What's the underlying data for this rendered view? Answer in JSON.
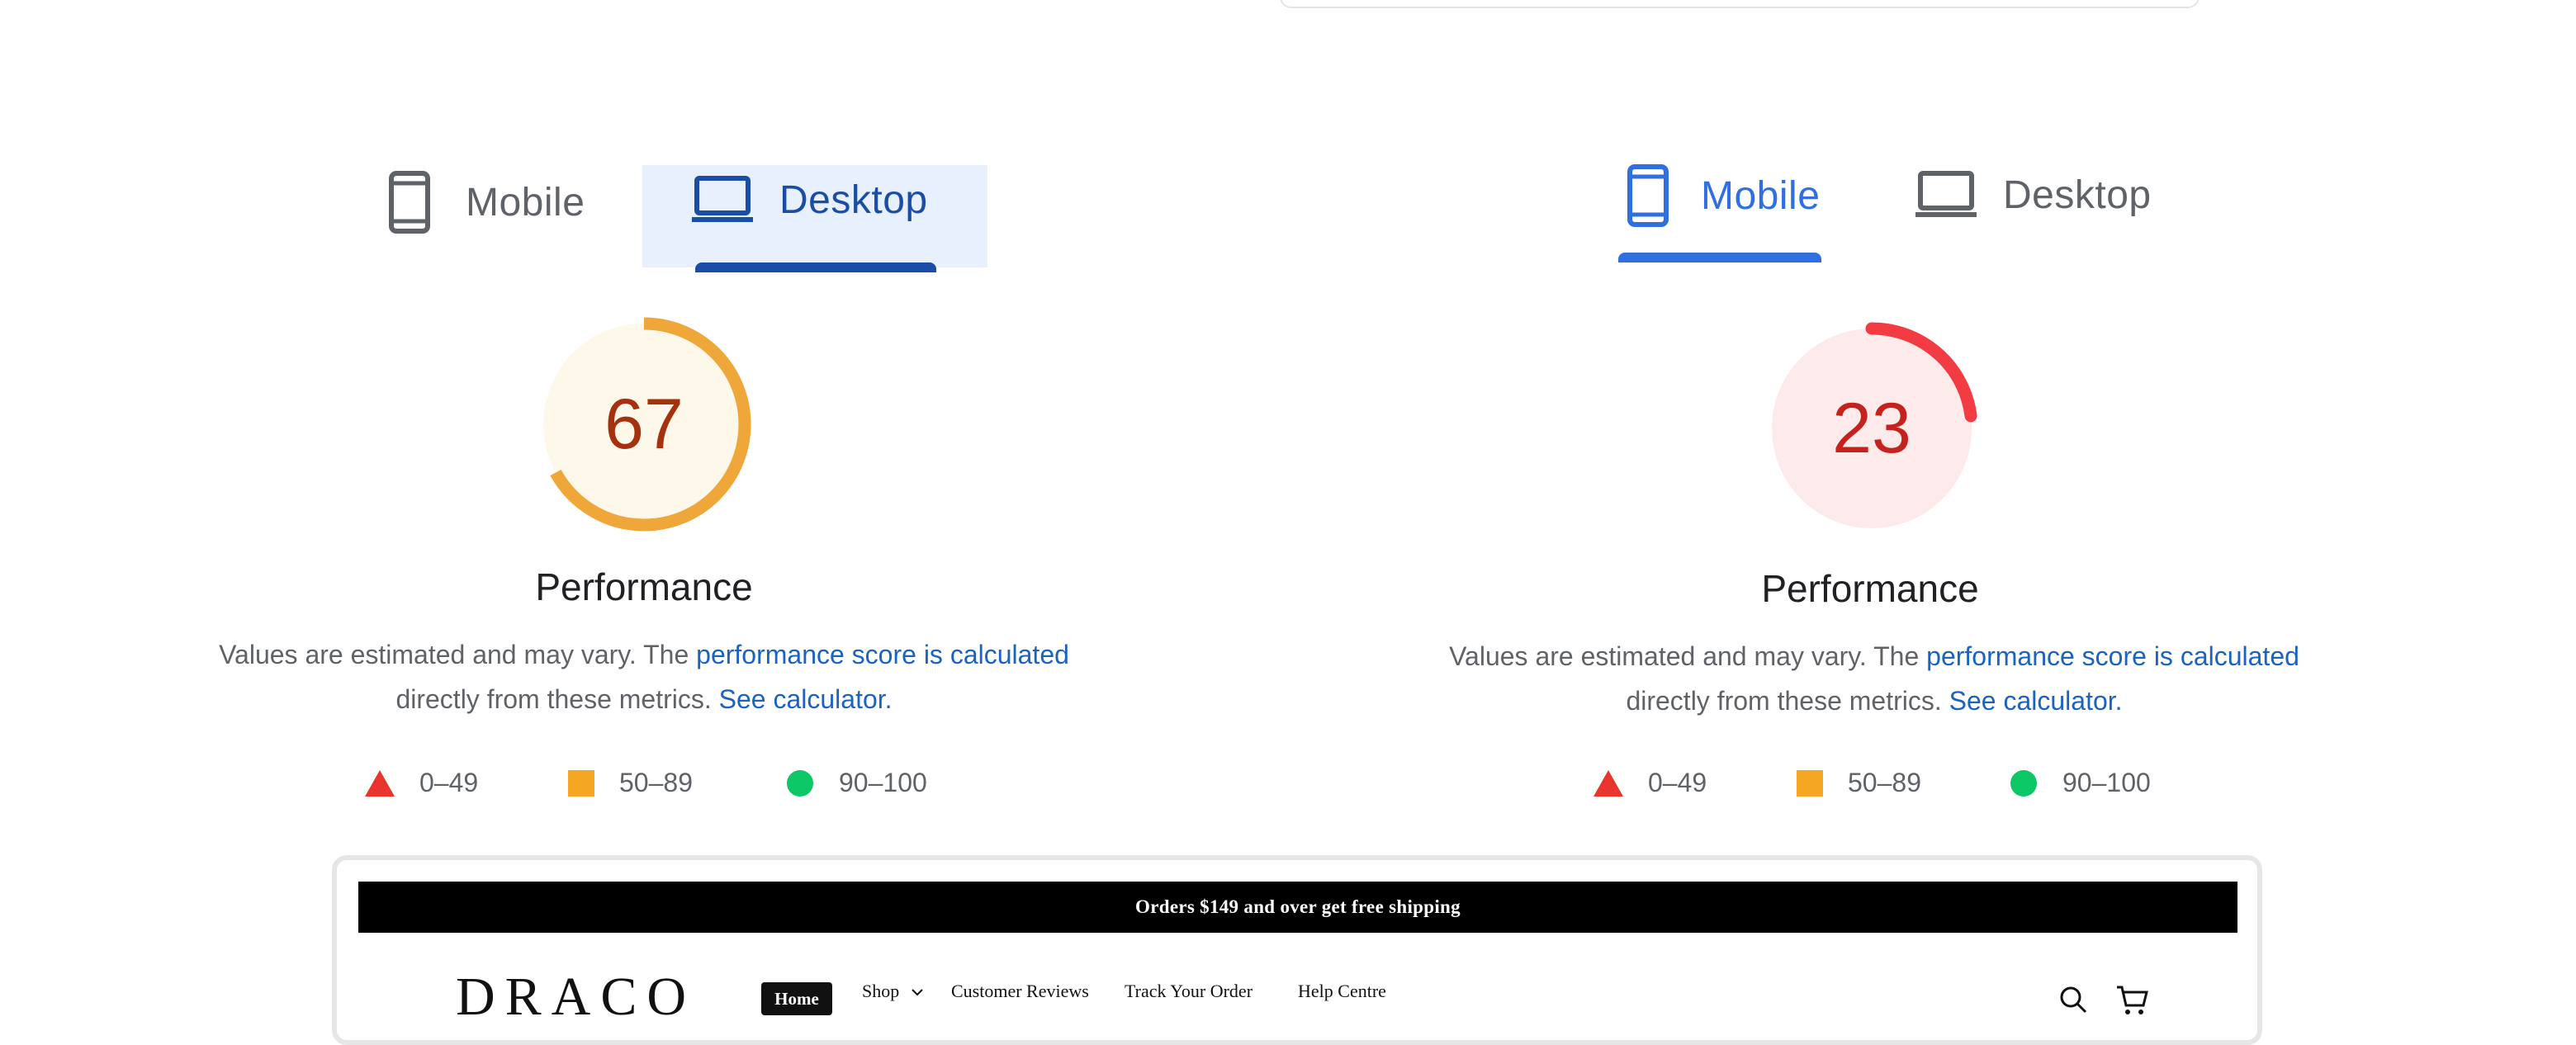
{
  "tabs_left": {
    "mobile_label": "Mobile",
    "desktop_label": "Desktop",
    "selected": "Desktop"
  },
  "tabs_right": {
    "mobile_label": "Mobile",
    "desktop_label": "Desktop",
    "selected": "Mobile"
  },
  "report_left": {
    "score": "67",
    "score_value": 67,
    "score_color": "#f0a73a",
    "score_text_color": "#a5310f",
    "score_bg": "#fef8ea",
    "title": "Performance",
    "desc_text": "Values are estimated and may vary. The",
    "desc_link": "performance score is calculated",
    "desc_text2": "directly from these metrics.",
    "desc_link2": "See calculator."
  },
  "report_right": {
    "score": "23",
    "score_value": 23,
    "score_color": "#f23b42",
    "score_text_color": "#c5221f",
    "score_bg": "#fdeaea",
    "title": "Performance",
    "desc_text": "Values are estimated and may vary. The",
    "desc_link": "performance score is calculated",
    "desc_text2": "directly from these metrics.",
    "desc_link2": "See calculator."
  },
  "legend": [
    {
      "label": "0–49",
      "shape": "triangle",
      "color": "#e9352e"
    },
    {
      "label": "50–89",
      "shape": "square",
      "color": "#f5a623"
    },
    {
      "label": "90–100",
      "shape": "circle",
      "color": "#0cc766"
    }
  ],
  "preview": {
    "announcement": "Orders $149 and over get free shipping",
    "brand": "DRACO",
    "nav": {
      "home": "Home",
      "shop": "Shop",
      "reviews": "Customer Reviews",
      "track": "Track Your Order",
      "help": "Help Centre"
    }
  }
}
